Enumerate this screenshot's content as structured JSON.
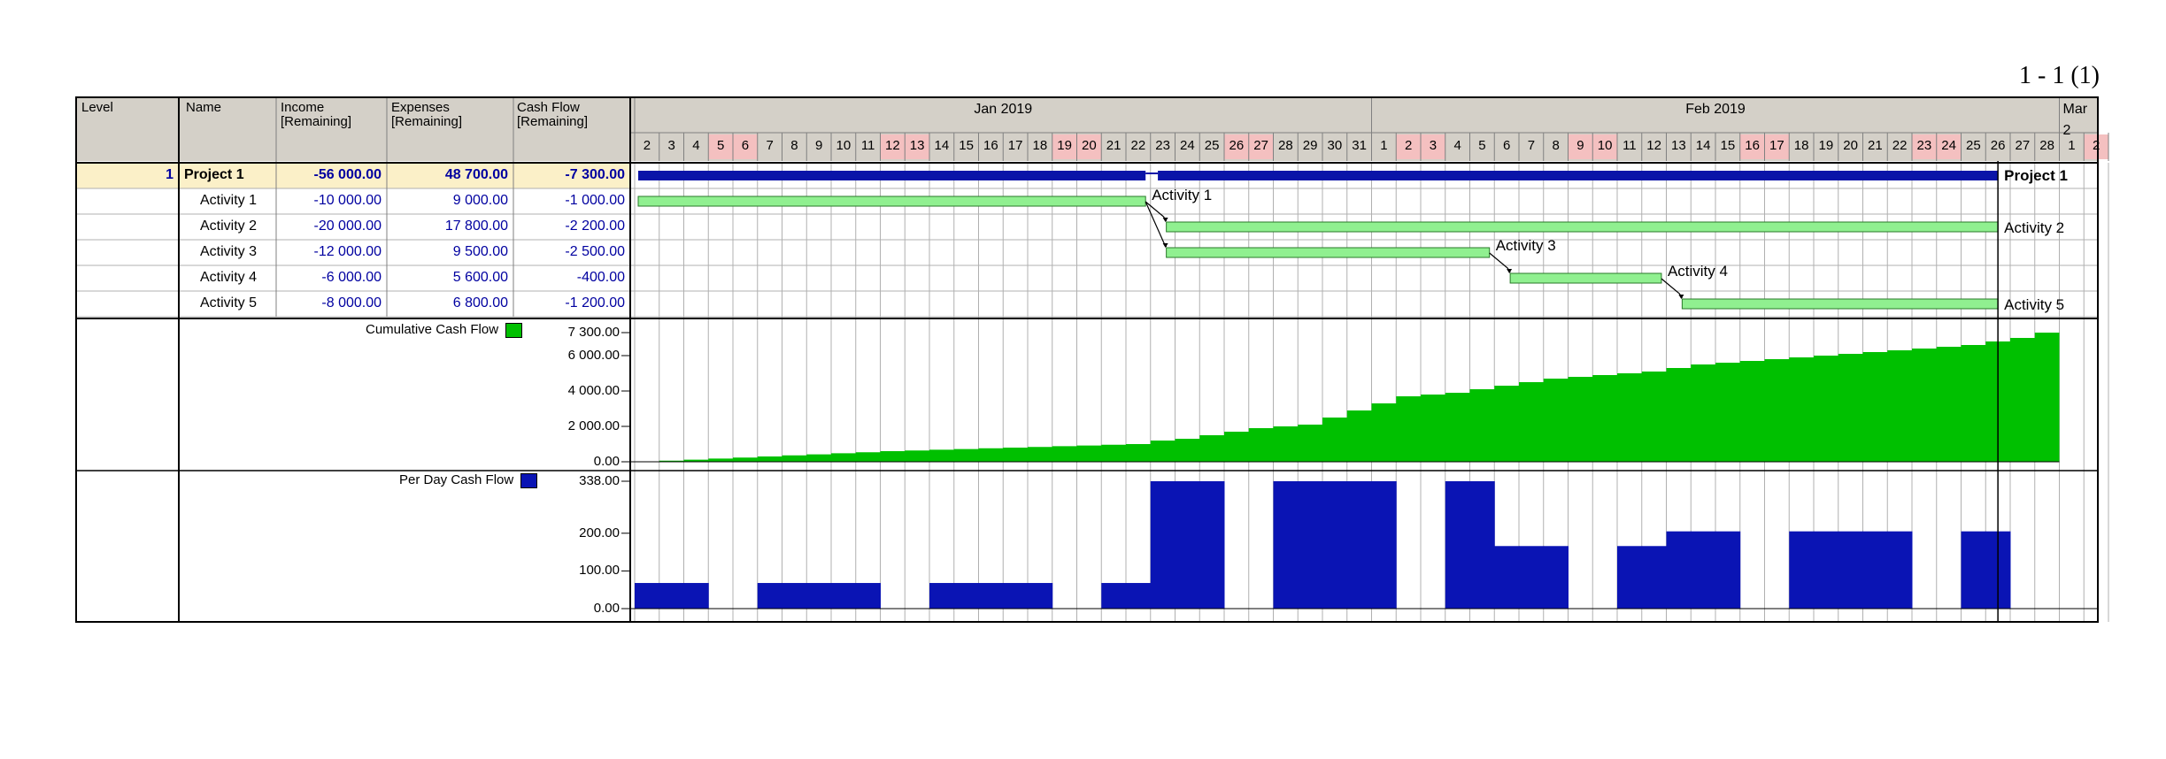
{
  "page_indicator": "1 - 1 (1)",
  "columns": {
    "level": "Level",
    "name": "Name",
    "income": "Income\n[Remaining]",
    "expenses": "Expenses\n[Remaining]",
    "cash_flow": "Cash Flow\n[Remaining]"
  },
  "timeline": {
    "months": [
      {
        "label": "Jan 2019",
        "start_index": 0,
        "span": 30
      },
      {
        "label": "Feb 2019",
        "start_index": 30,
        "span": 28
      },
      {
        "label": "Mar 2",
        "start_index": 58,
        "span": 2
      }
    ],
    "days": [
      {
        "d": "2",
        "w": false
      },
      {
        "d": "3",
        "w": false
      },
      {
        "d": "4",
        "w": false
      },
      {
        "d": "5",
        "w": true
      },
      {
        "d": "6",
        "w": true
      },
      {
        "d": "7",
        "w": false
      },
      {
        "d": "8",
        "w": false
      },
      {
        "d": "9",
        "w": false
      },
      {
        "d": "10",
        "w": false
      },
      {
        "d": "11",
        "w": false
      },
      {
        "d": "12",
        "w": true
      },
      {
        "d": "13",
        "w": true
      },
      {
        "d": "14",
        "w": false
      },
      {
        "d": "15",
        "w": false
      },
      {
        "d": "16",
        "w": false
      },
      {
        "d": "17",
        "w": false
      },
      {
        "d": "18",
        "w": false
      },
      {
        "d": "19",
        "w": true
      },
      {
        "d": "20",
        "w": true
      },
      {
        "d": "21",
        "w": false
      },
      {
        "d": "22",
        "w": false
      },
      {
        "d": "23",
        "w": false
      },
      {
        "d": "24",
        "w": false
      },
      {
        "d": "25",
        "w": false
      },
      {
        "d": "26",
        "w": true
      },
      {
        "d": "27",
        "w": true
      },
      {
        "d": "28",
        "w": false
      },
      {
        "d": "29",
        "w": false
      },
      {
        "d": "30",
        "w": false
      },
      {
        "d": "31",
        "w": false
      },
      {
        "d": "1",
        "w": false
      },
      {
        "d": "2",
        "w": true
      },
      {
        "d": "3",
        "w": true
      },
      {
        "d": "4",
        "w": false
      },
      {
        "d": "5",
        "w": false
      },
      {
        "d": "6",
        "w": false
      },
      {
        "d": "7",
        "w": false
      },
      {
        "d": "8",
        "w": false
      },
      {
        "d": "9",
        "w": true
      },
      {
        "d": "10",
        "w": true
      },
      {
        "d": "11",
        "w": false
      },
      {
        "d": "12",
        "w": false
      },
      {
        "d": "13",
        "w": false
      },
      {
        "d": "14",
        "w": false
      },
      {
        "d": "15",
        "w": false
      },
      {
        "d": "16",
        "w": true
      },
      {
        "d": "17",
        "w": true
      },
      {
        "d": "18",
        "w": false
      },
      {
        "d": "19",
        "w": false
      },
      {
        "d": "20",
        "w": false
      },
      {
        "d": "21",
        "w": false
      },
      {
        "d": "22",
        "w": false
      },
      {
        "d": "23",
        "w": true
      },
      {
        "d": "24",
        "w": true
      },
      {
        "d": "25",
        "w": false
      },
      {
        "d": "26",
        "w": false
      },
      {
        "d": "27",
        "w": false
      },
      {
        "d": "28",
        "w": false
      },
      {
        "d": "1",
        "w": false
      },
      {
        "d": "2",
        "w": true
      }
    ]
  },
  "rows": [
    {
      "level": "1",
      "name": "Project 1",
      "income": "-56 000.00",
      "expenses": "48 700.00",
      "cash_flow": "-7 300.00",
      "summary": true,
      "bar_start": 0,
      "bar_end": 55.5,
      "bar_label": "Project 1"
    },
    {
      "level": "",
      "name": "Activity 1",
      "income": "-10 000.00",
      "expenses": "9 000.00",
      "cash_flow": "-1 000.00",
      "summary": false,
      "bar_start": 0,
      "bar_end": 20.8,
      "bar_label": "Activity 1"
    },
    {
      "level": "",
      "name": "Activity 2",
      "income": "-20 000.00",
      "expenses": "17 800.00",
      "cash_flow": "-2 200.00",
      "summary": false,
      "bar_start": 21.5,
      "bar_end": 55.5,
      "bar_label": "Activity 2"
    },
    {
      "level": "",
      "name": "Activity 3",
      "income": "-12 000.00",
      "expenses": "9 500.00",
      "cash_flow": "-2 500.00",
      "summary": false,
      "bar_start": 21.5,
      "bar_end": 34.8,
      "bar_label": "Activity 3"
    },
    {
      "level": "",
      "name": "Activity 4",
      "income": "-6 000.00",
      "expenses": "5 600.00",
      "cash_flow": "-400.00",
      "summary": false,
      "bar_start": 35.5,
      "bar_end": 41.8,
      "bar_label": "Activity 4"
    },
    {
      "level": "",
      "name": "Activity 5",
      "income": "-8 000.00",
      "expenses": "6 800.00",
      "cash_flow": "-1 200.00",
      "summary": false,
      "bar_start": 42.5,
      "bar_end": 55.5,
      "bar_label": "Activity 5"
    }
  ],
  "colors": {
    "header_bg": "#d4d0c8",
    "weekend_bg": "#f4c0c0",
    "summary_row_bg": "#fbf0c8",
    "summary_bar": "#0a14a8",
    "activity_bar": "#90f090",
    "cumulative_fill": "#00c000",
    "per_day_fill": "#0a14b4",
    "value_text": "#0000a0"
  },
  "chart_data": [
    {
      "type": "area",
      "title": "",
      "series": [
        {
          "name": "Cumulative Cash Flow",
          "color": "#00c000",
          "values": [
            0,
            60,
            120,
            180,
            240,
            300,
            360,
            420,
            480,
            540,
            600,
            640,
            680,
            720,
            760,
            800,
            840,
            880,
            920,
            960,
            1000,
            1200,
            1300,
            1500,
            1700,
            1900,
            2000,
            2100,
            2500,
            2900,
            3300,
            3700,
            3800,
            3900,
            4100,
            4300,
            4500,
            4700,
            4800,
            4900,
            5000,
            5100,
            5300,
            5500,
            5600,
            5700,
            5800,
            5900,
            6000,
            6100,
            6200,
            6300,
            6400,
            6500,
            6600,
            6800,
            7000,
            7300
          ]
        }
      ],
      "ylim": [
        0,
        7300
      ],
      "yticks": [
        "7 300.00",
        "6 000.00",
        "4 000.00",
        "2 000.00",
        "0.00"
      ],
      "ytick_values": [
        7300,
        6000,
        4000,
        2000,
        0
      ]
    },
    {
      "type": "bar",
      "title": "",
      "series": [
        {
          "name": "Per Day Cash Flow",
          "color": "#0a14b4",
          "values": [
            68,
            68,
            68,
            0,
            0,
            68,
            68,
            68,
            68,
            68,
            0,
            0,
            68,
            68,
            68,
            68,
            68,
            0,
            0,
            68,
            68,
            338,
            338,
            338,
            0,
            0,
            338,
            338,
            338,
            338,
            338,
            0,
            0,
            338,
            338,
            166,
            166,
            166,
            0,
            0,
            166,
            166,
            205,
            205,
            205,
            0,
            0,
            205,
            205,
            205,
            205,
            205,
            0,
            0,
            205,
            205,
            0,
            0,
            0,
            0
          ]
        }
      ],
      "ylim": [
        0,
        338
      ],
      "yticks": [
        "338.00",
        "200.00",
        "100.00",
        "0.00"
      ],
      "ytick_values": [
        338,
        200,
        100,
        0
      ]
    }
  ]
}
